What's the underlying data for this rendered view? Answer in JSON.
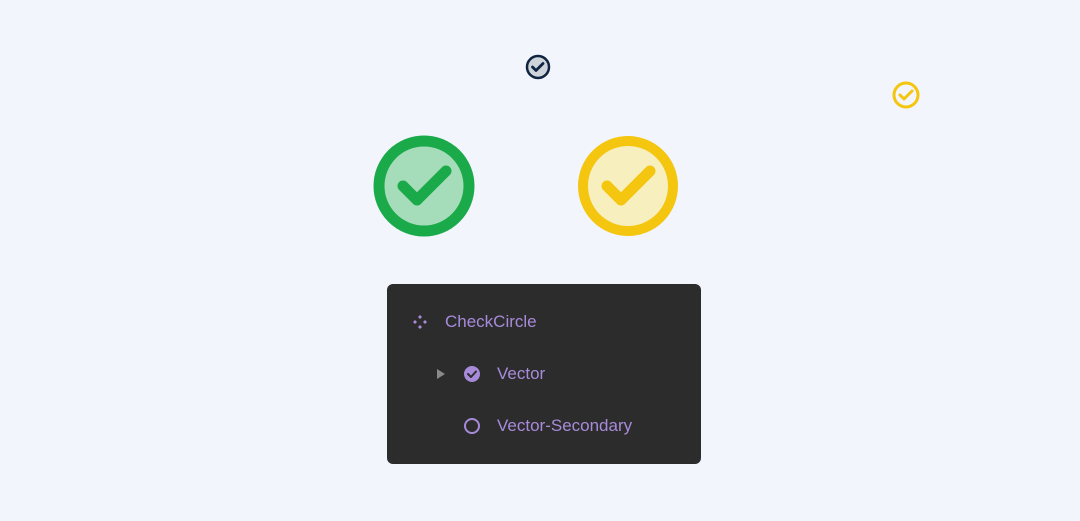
{
  "colors": {
    "green": "#1aaa4a",
    "greenFill": "#a5dcb9",
    "yellow": "#f4c60f",
    "yellowFill": "#f7efbe",
    "darkStroke": "#0f2440",
    "darkFill": "#cfd3da",
    "panelBg": "#2c2c2c",
    "purple": "#a78bda",
    "triangleGray": "#8a8a8a"
  },
  "layers": {
    "component": {
      "label": "CheckCircle"
    },
    "vector": {
      "label": "Vector"
    },
    "vectorSecondary": {
      "label": "Vector-Secondary"
    }
  }
}
